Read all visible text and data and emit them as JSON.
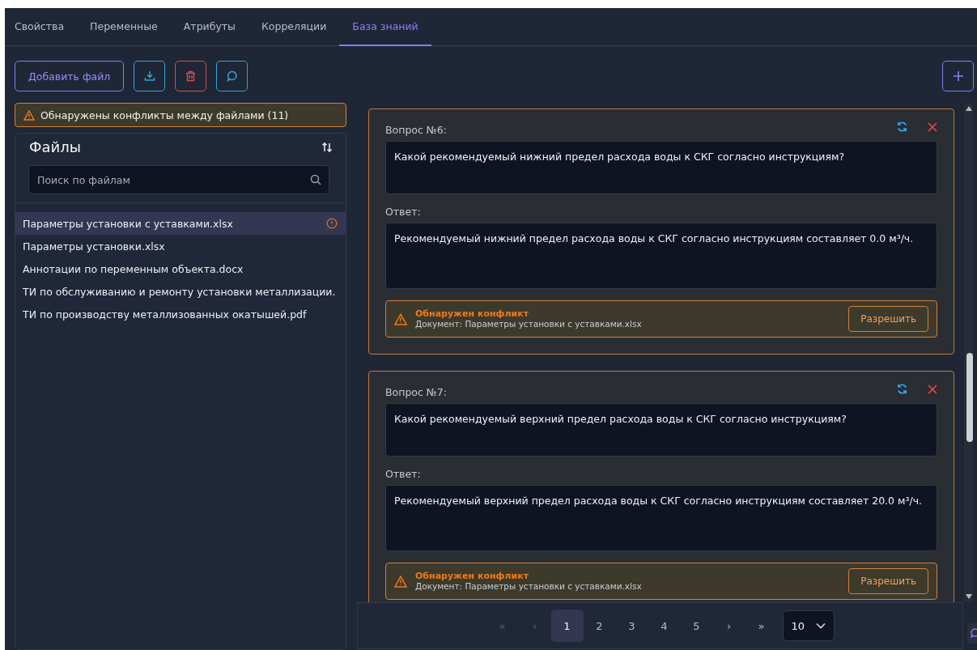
{
  "tabs": [
    {
      "label": "Свойства",
      "selected": false
    },
    {
      "label": "Переменные",
      "selected": false
    },
    {
      "label": "Атрибуты",
      "selected": false
    },
    {
      "label": "Корреляции",
      "selected": false
    },
    {
      "label": "База знаний",
      "selected": true
    }
  ],
  "toolbar": {
    "add_button": "Добавить файл"
  },
  "conflict_banner": "Обнаружены конфликты между файлами (11)",
  "files_panel": {
    "title": "Файлы",
    "search": {
      "placeholder": "Поиск по файлам"
    },
    "files": [
      {
        "name": "Параметры установки с уставками.xlsx",
        "selected": true,
        "conflict": true
      },
      {
        "name": "Параметры установки.xlsx",
        "selected": false,
        "conflict": false
      },
      {
        "name": "Аннотации по переменным объекта.docx",
        "selected": false,
        "conflict": false
      },
      {
        "name": "ТИ по обслуживанию и ремонту установки металлизации.",
        "selected": false,
        "conflict": false
      },
      {
        "name": "ТИ по производству металлизованных окатышей.pdf",
        "selected": false,
        "conflict": false
      }
    ]
  },
  "cards": [
    {
      "question_label": "Вопрос №6:",
      "question": "Какой рекомендуемый нижний предел расхода воды к СКГ согласно инструкциям?",
      "answer_label": "Ответ:",
      "answer": "Рекомендуемый нижний предел расхода воды к СКГ согласно инструкциям составляет 0.0 м³/ч.",
      "conflict": {
        "title": "Обнаружен конфликт",
        "document": "Документ: Параметры установки с уставками.xlsx",
        "button": "Разрешить"
      }
    },
    {
      "question_label": "Вопрос №7:",
      "question": "Какой рекомендуемый верхний предел расхода воды к СКГ согласно инструкциям?",
      "answer_label": "Ответ:",
      "answer": "Рекомендуемый верхний предел расхода воды к СКГ согласно инструкциям составляет 20.0 м³/ч.",
      "conflict": {
        "title": "Обнаружен конфликт",
        "document": "Документ: Параметры установки с уставками.xlsx",
        "button": "Разрешить"
      }
    }
  ],
  "pagination": {
    "first": {
      "label": "«",
      "disabled": true
    },
    "prev": {
      "label": "‹",
      "disabled": true
    },
    "pages": [
      {
        "label": "1",
        "selected": true
      },
      {
        "label": "2",
        "selected": false
      },
      {
        "label": "3",
        "selected": false
      },
      {
        "label": "4",
        "selected": false
      },
      {
        "label": "5",
        "selected": false
      }
    ],
    "next": {
      "label": "›",
      "disabled": false
    },
    "last": {
      "label": "»",
      "disabled": false
    },
    "page_size": "10"
  }
}
